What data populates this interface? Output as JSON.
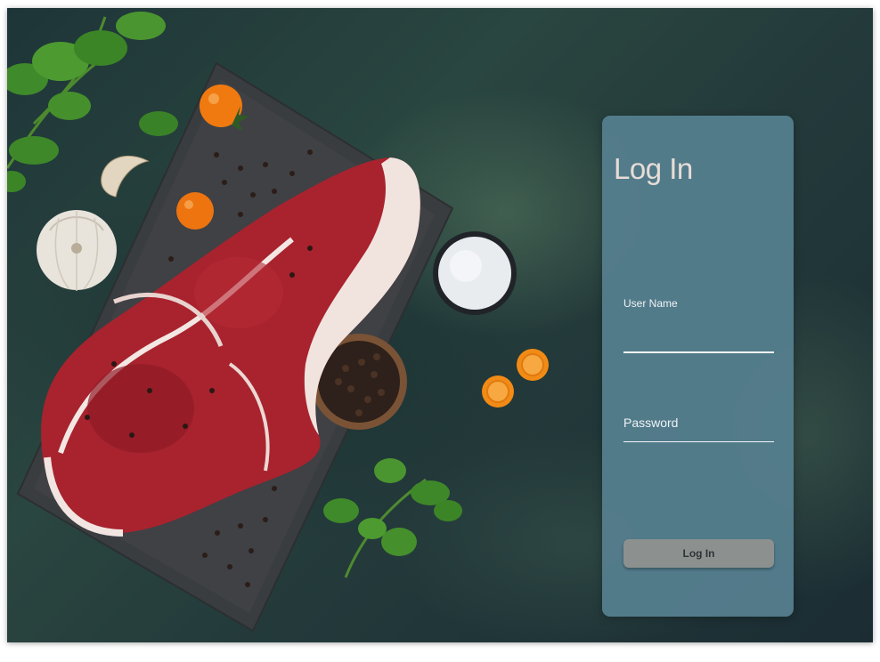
{
  "login": {
    "title": "Log In",
    "username_label": "User Name",
    "username_value": "",
    "password_label": "Password",
    "password_value": "",
    "button_label": "Log In"
  },
  "colors": {
    "card_background": "#568090",
    "button_background": "#8c918f",
    "title_color": "#e7ddd7",
    "background_dark": "#1e3538"
  }
}
